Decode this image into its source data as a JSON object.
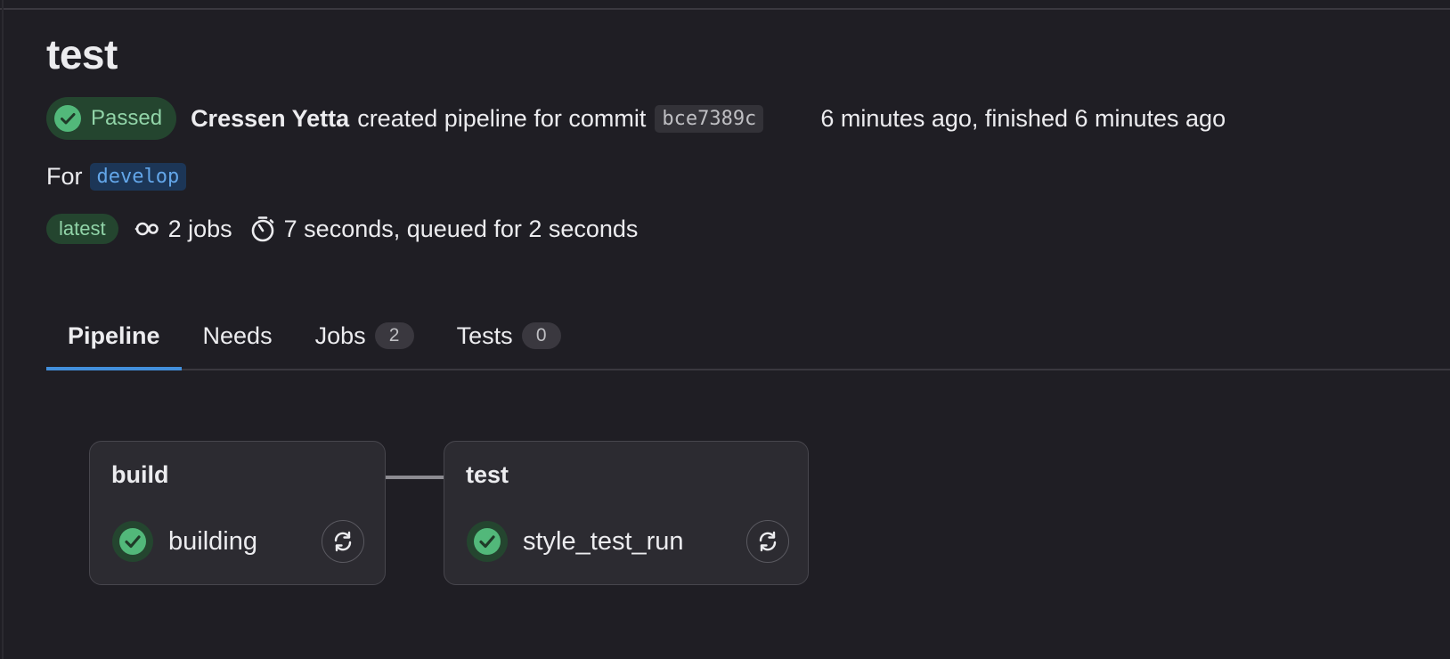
{
  "header": {
    "title": "test",
    "status_label": "Passed",
    "author": "Cressen Yetta",
    "action_text": "created pipeline for commit",
    "commit_sha": "bce7389c",
    "timing": "6 minutes ago, finished 6 minutes ago",
    "for_label": "For",
    "branch": "develop",
    "latest_badge": "latest",
    "jobs_summary": "2 jobs",
    "duration": "7 seconds, queued for 2 seconds"
  },
  "tabs": [
    {
      "label": "Pipeline",
      "active": true
    },
    {
      "label": "Needs"
    },
    {
      "label": "Jobs",
      "count": "2"
    },
    {
      "label": "Tests",
      "count": "0"
    }
  ],
  "stages": [
    {
      "name": "build",
      "jobs": [
        {
          "name": "building",
          "status": "success"
        }
      ]
    },
    {
      "name": "test",
      "jobs": [
        {
          "name": "style_test_run",
          "status": "success"
        }
      ]
    }
  ],
  "colors": {
    "background": "#1f1e24",
    "success_green": "#2da160",
    "success_text": "#91d4a8",
    "active_tab_accent": "#428fdc",
    "branch_text": "#63a6e9"
  },
  "icons": {
    "status": "check-circle-icon",
    "jobs": "pipeline-jobs-icon",
    "duration": "stopwatch-icon",
    "retry": "retry-icon"
  }
}
